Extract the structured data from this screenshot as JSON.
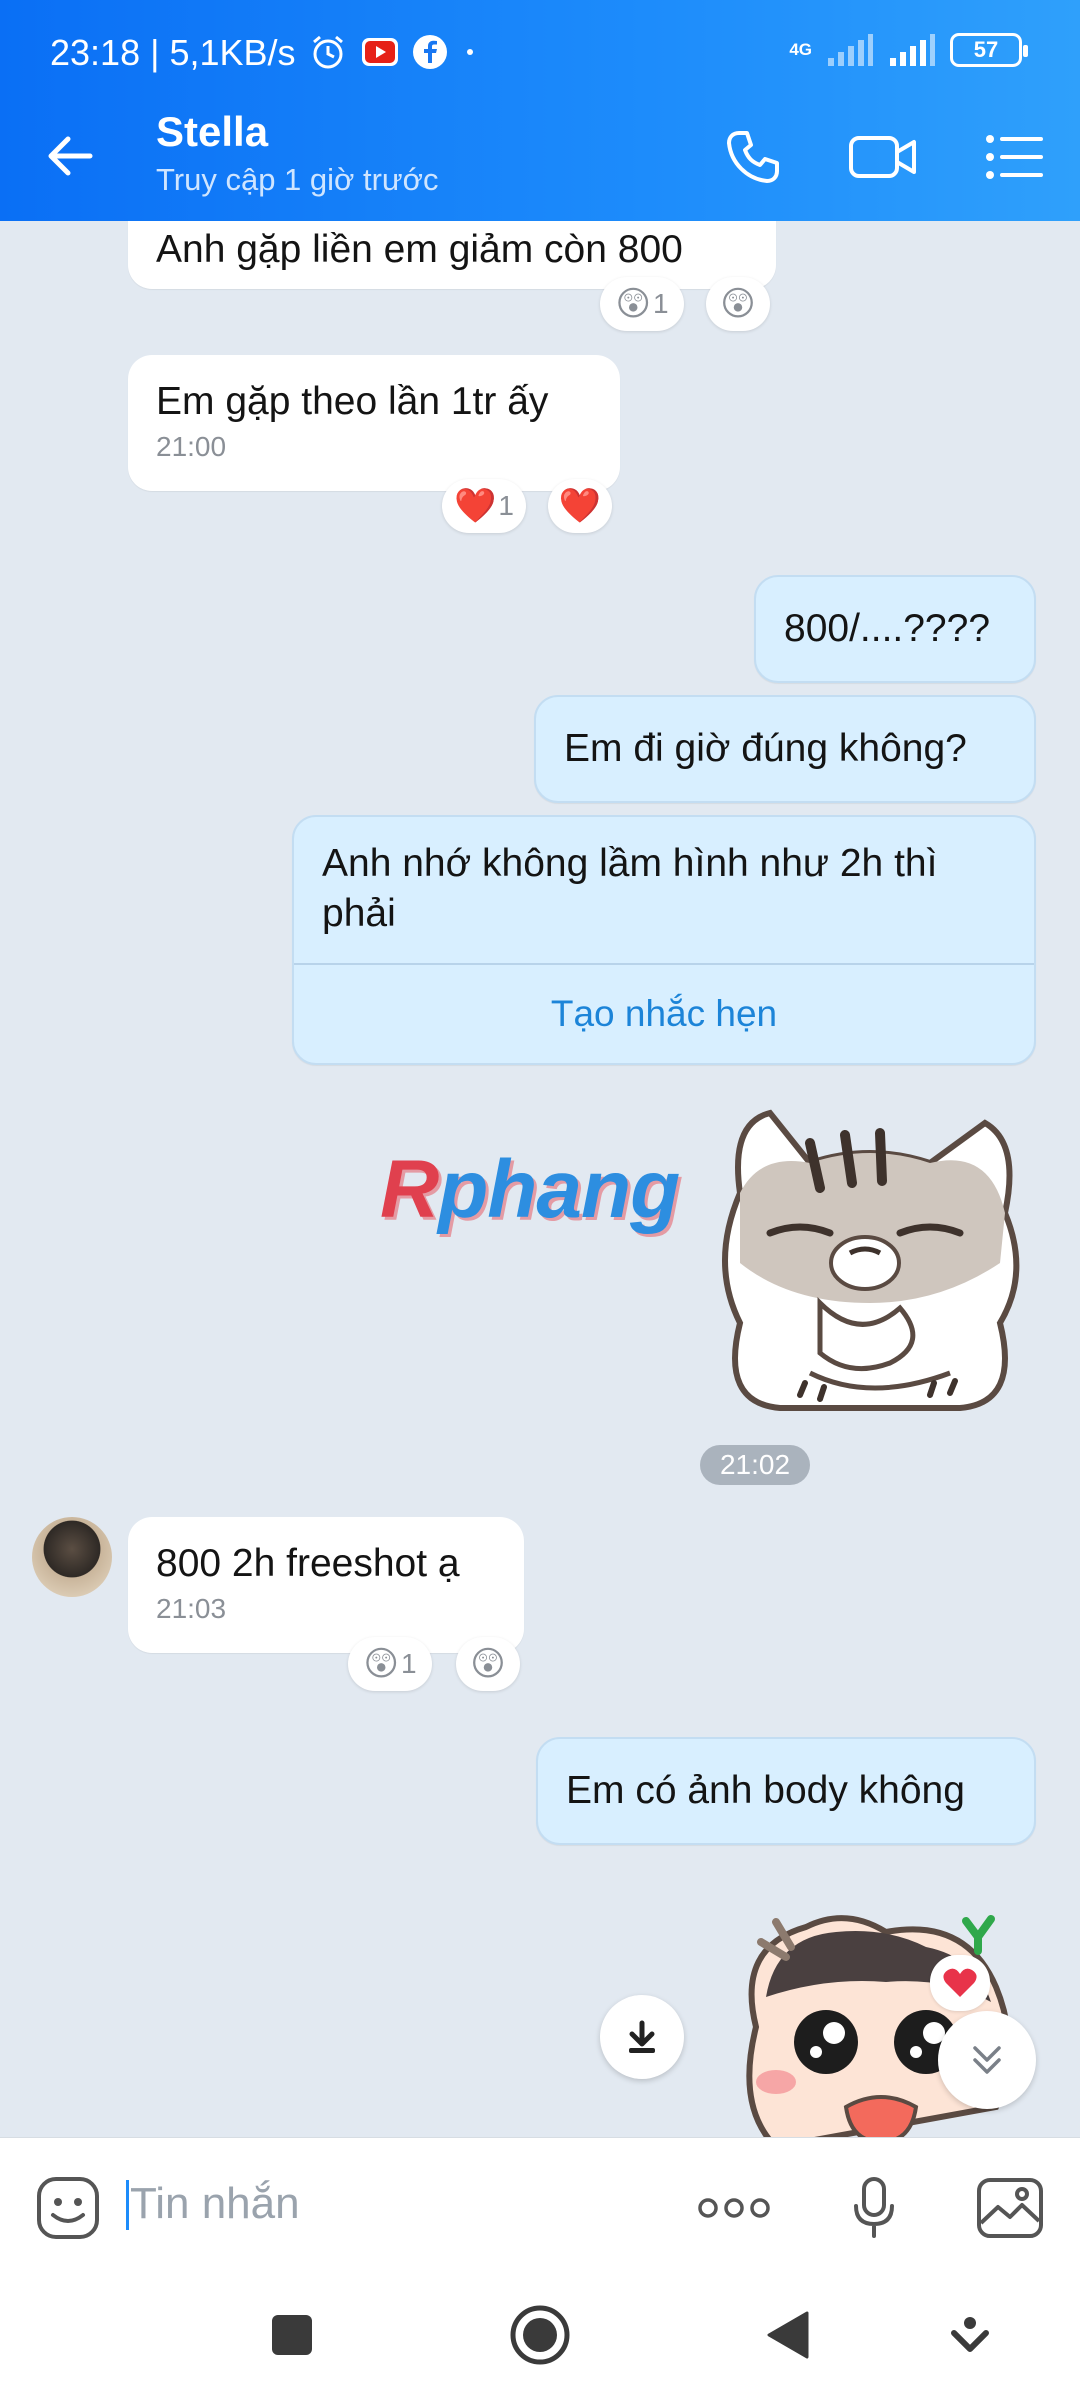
{
  "status_bar": {
    "time_speed": "23:18 | 5,1KB/s",
    "network": "4G",
    "battery": "57"
  },
  "header": {
    "contact_name": "Stella",
    "contact_status": "Truy cập 1 giờ trước"
  },
  "messages": [
    {
      "side": "in",
      "text": "Anh gặp liền em giảm còn 800",
      "reaction": "😲",
      "reaction_count": "1"
    },
    {
      "side": "in",
      "text": "Em gặp theo lần 1tr ấy",
      "time": "21:00",
      "reaction": "❤️",
      "reaction_count": "1"
    },
    {
      "side": "out",
      "text": "800/....????"
    },
    {
      "side": "out",
      "text": "Em đi giờ đúng không?"
    },
    {
      "side": "out",
      "text": "Anh nhớ không lầm hình như 2h thì phải",
      "action": "Tạo nhắc hẹn"
    },
    {
      "side": "out",
      "type": "sticker",
      "sticker": "grumpy-cat-sticker"
    },
    {
      "side": "in",
      "text": "800 2h freeshot ạ",
      "time": "21:03",
      "reaction": "😲",
      "reaction_count": "1"
    },
    {
      "side": "out",
      "text": "Em có ảnh body không"
    },
    {
      "side": "out",
      "type": "sticker",
      "sticker": "crying-baby-sticker"
    }
  ],
  "time_divider": "21:02",
  "watermark": {
    "r": "R",
    "rest": "phang"
  },
  "input": {
    "placeholder": "Tin nhắn",
    "value": ""
  },
  "colors": {
    "header": "#1d8cfb",
    "chat_bg": "#e2e9f1",
    "outgoing_bubble": "#d8efff",
    "incoming_bubble": "#ffffff",
    "link": "#1c84d8"
  },
  "icons": [
    "back-arrow-icon",
    "phone-icon",
    "video-call-icon",
    "menu-icon",
    "emoji-icon",
    "more-icon",
    "microphone-icon",
    "image-icon",
    "download-icon",
    "scroll-down-icon"
  ]
}
